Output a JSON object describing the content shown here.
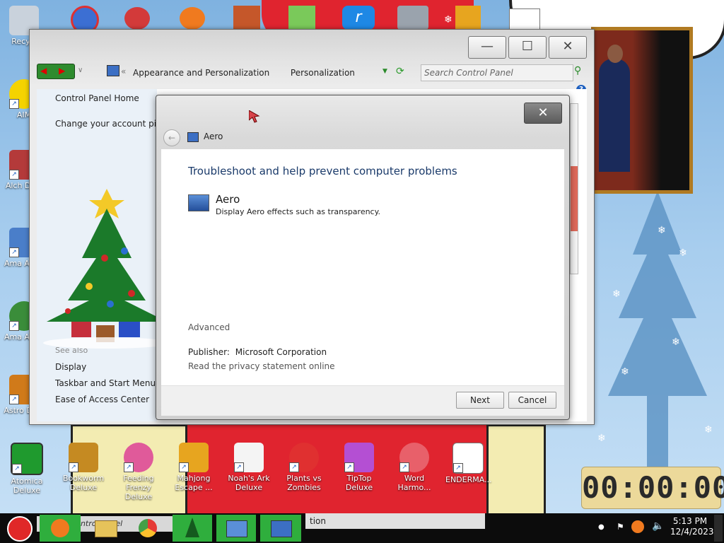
{
  "desktop": {
    "left_icons": [
      {
        "label": "Recycl",
        "color": "#c9d2dc"
      },
      {
        "label": "AIM",
        "color": "#f5d300"
      },
      {
        "label": "Alch Delu",
        "color": "#b43a3a"
      },
      {
        "label": "Ama Adve",
        "color": "#4a7ec9"
      },
      {
        "label": "Ama Adve",
        "color": "#3a8d3a"
      },
      {
        "label": "Astro Delu",
        "color": "#d07a1a"
      }
    ],
    "bottom_icons": [
      {
        "label": "Atomica Deluxe",
        "color": "#1f9a2e"
      },
      {
        "label": "Bookworm Deluxe",
        "color": "#c58a22"
      },
      {
        "label": "Feeding Frenzy Deluxe",
        "color": "#e05a9a"
      },
      {
        "label": "Mahjong Escape ...",
        "color": "#e7a51f"
      },
      {
        "label": "Noah's Ark Deluxe",
        "color": "#f4f4f4"
      },
      {
        "label": "Plants vs Zombies",
        "color": "#e03030"
      },
      {
        "label": "TipTop Deluxe",
        "color": "#b44fd3"
      },
      {
        "label": "Word Harmo...",
        "color": "#e8606a"
      },
      {
        "label": "ENDERMA...",
        "color": "#4a8bd1"
      }
    ],
    "stopwatch": "00:00:00"
  },
  "window": {
    "nav": {
      "breadcrumb_parent": "Appearance and Personalization",
      "breadcrumb_current": "Personalization"
    },
    "search_placeholder": "Search Control Panel",
    "buttons": {
      "minimize": "—",
      "maximize": "☐",
      "close": "✕"
    },
    "left_links": {
      "home": "Control Panel Home",
      "change_picture": "Change your account pictu",
      "see_also": "See also",
      "display": "Display",
      "taskbar": "Taskbar and Start Menu",
      "ease": "Ease of Access Center"
    }
  },
  "dialog": {
    "title": "Aero",
    "heading": "Troubleshoot and help prevent computer problems",
    "item": {
      "name": "Aero",
      "description": "Display Aero effects such as transparency."
    },
    "advanced": "Advanced",
    "publisher_label": "Publisher:",
    "publisher_value": "Microsoft Corporation",
    "privacy_link": "Read the privacy statement online",
    "next": "Next",
    "cancel": "Cancel",
    "close": "✕"
  },
  "taskbar": {
    "search_text": "Search Control Panel",
    "window_label": "tion",
    "time": "5:13 PM",
    "date": "12/4/2023"
  },
  "colors": {
    "accent": "#1d5fbf",
    "link": "#1a4f99",
    "taskbar_highlight": "#2fae3d"
  }
}
